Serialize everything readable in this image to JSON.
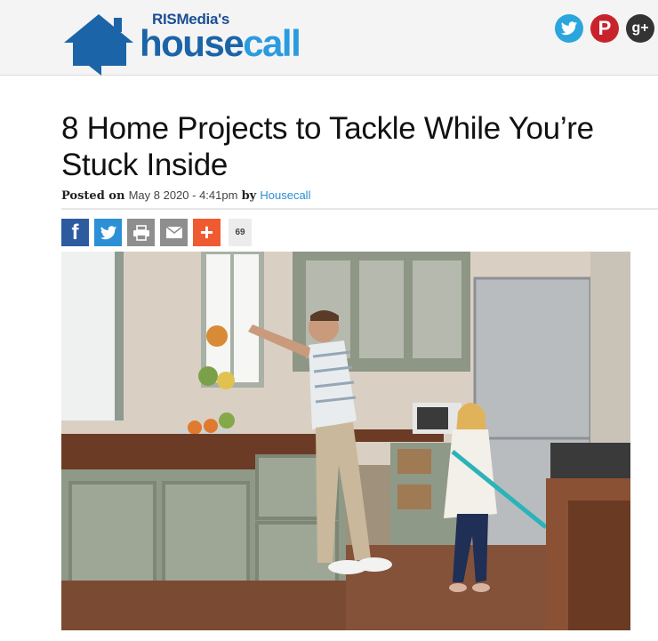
{
  "brand": {
    "top": "RISMedia's",
    "main_a": "house",
    "main_b": "call"
  },
  "social": {
    "twitter": "twitter-icon",
    "pinterest": "pinterest-icon",
    "gplus": "google-plus-icon"
  },
  "article": {
    "title": "8 Home Projects to Tackle While You’re Stuck Inside",
    "posted_on_label": "Posted on",
    "date": "May 8 2020 - 4:41pm",
    "by_label": "by",
    "author": "Housecall"
  },
  "share": {
    "count": "69"
  },
  "photo": {
    "subject": "kitchen-scene"
  }
}
